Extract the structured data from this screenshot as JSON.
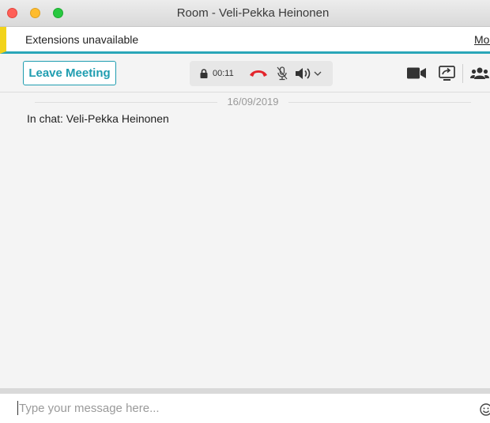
{
  "window": {
    "title": "Room - Veli-Pekka Heinonen"
  },
  "banner": {
    "text": "Extensions unavailable",
    "link": "Mor"
  },
  "toolbar": {
    "leave_label": "Leave Meeting",
    "call": {
      "timer": "00:11"
    }
  },
  "chat": {
    "date": "16/09/2019",
    "messages": [
      {
        "text": "In chat: Veli-Pekka Heinonen"
      }
    ]
  },
  "composer": {
    "placeholder": "Type your message here...",
    "value": ""
  },
  "colors": {
    "accent": "#1f9db0",
    "hangup": "#e3242b",
    "banner_stripe": "#f2d31a",
    "toolbar_icons": "#333333"
  }
}
